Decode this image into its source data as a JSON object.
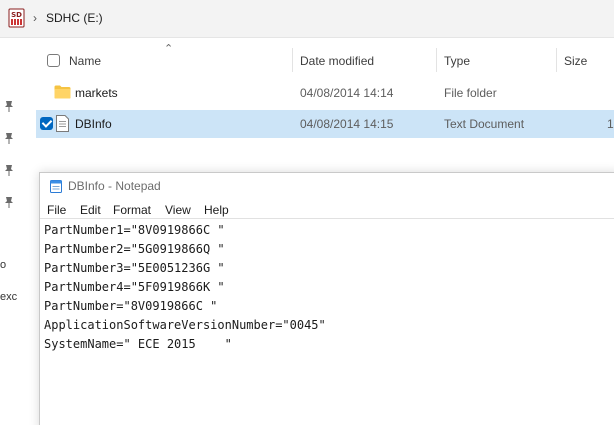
{
  "explorer": {
    "breadcrumb": {
      "location": "SDHC (E:)"
    },
    "columns": {
      "name": "Name",
      "date_modified": "Date modified",
      "type": "Type",
      "size": "Size"
    },
    "files": [
      {
        "name": "markets",
        "date": "04/08/2014 14:14",
        "type": "File folder",
        "size": "",
        "icon": "folder-icon",
        "selected": false
      },
      {
        "name": "DBInfo",
        "date": "04/08/2014 14:15",
        "type": "Text Document",
        "size": "1",
        "icon": "text-document-icon",
        "selected": true
      }
    ],
    "left_pane": {
      "partial_text_1": "o",
      "partial_text_2": "exc"
    },
    "colors": {
      "selection": "#cce4f7",
      "checkbox_accent": "#0067c0",
      "folder": "#f5c342"
    }
  },
  "notepad": {
    "title": "DBInfo - Notepad",
    "menu": [
      "File",
      "Edit",
      "Format",
      "View",
      "Help"
    ],
    "lines": [
      "PartNumber1=\"8V0919866C \"",
      "PartNumber2=\"5G0919866Q \"",
      "PartNumber3=\"5E0051236G \"",
      "PartNumber4=\"5F0919866K \"",
      "PartNumber=\"8V0919866C \"",
      "ApplicationSoftwareVersionNumber=\"0045\"",
      "SystemName=\" ECE 2015    \""
    ]
  }
}
